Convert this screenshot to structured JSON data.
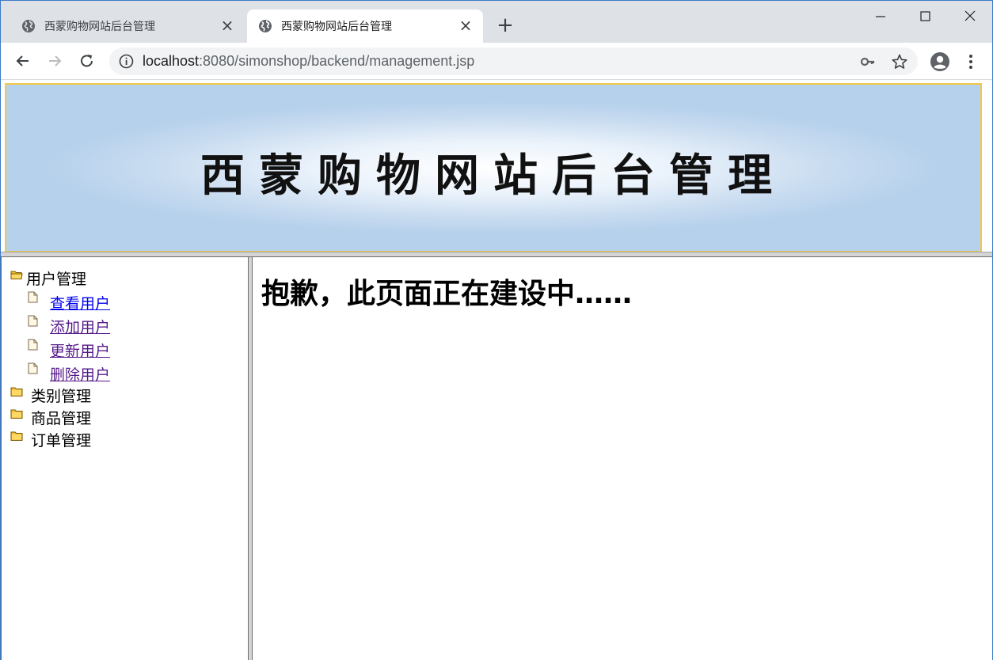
{
  "browser": {
    "tabs": [
      {
        "title": "西蒙购物网站后台管理",
        "active": false
      },
      {
        "title": "西蒙购物网站后台管理",
        "active": true
      }
    ],
    "address": {
      "host": "localhost",
      "path": ":8080/simonshop/backend/management.jsp"
    }
  },
  "banner": {
    "title": "西蒙购物网站后台管理",
    "colors": {
      "border": "#f2c94c",
      "background": "#b6d1ec"
    }
  },
  "menu": {
    "user_group": "用户管理",
    "user_items": [
      "查看用户",
      "添加用户",
      "更新用户",
      "删除用户"
    ],
    "category_group": "类别管理",
    "product_group": "商品管理",
    "order_group": "订单管理"
  },
  "main": {
    "message": "抱歉，此页面正在建设中……"
  }
}
